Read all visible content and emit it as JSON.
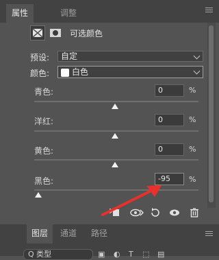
{
  "tabs": [
    {
      "label": "属性"
    },
    {
      "label": "调整"
    }
  ],
  "header": {
    "title": "可选颜色"
  },
  "preset": {
    "label": "预设:",
    "value": "自定"
  },
  "colors": {
    "label": "颜色:",
    "value": "白色",
    "swatch_color": "#ffffff"
  },
  "channels": [
    {
      "label": "青色:",
      "value": "0",
      "unit": "%",
      "slider_level": 0
    },
    {
      "label": "洋红:",
      "value": "0",
      "unit": "%",
      "slider_level": 0
    },
    {
      "label": "黄色:",
      "value": "0",
      "unit": "%",
      "slider_level": 0
    },
    {
      "label": "黑色:",
      "value": "-95",
      "unit": "%",
      "slider_level": -95
    }
  ],
  "bottom_tabs": [
    {
      "label": "图层"
    },
    {
      "label": "通道"
    },
    {
      "label": "路径"
    }
  ],
  "layers_search": {
    "text": "Q 类型"
  },
  "annotation": {
    "arrow_color": "#e8312b"
  }
}
